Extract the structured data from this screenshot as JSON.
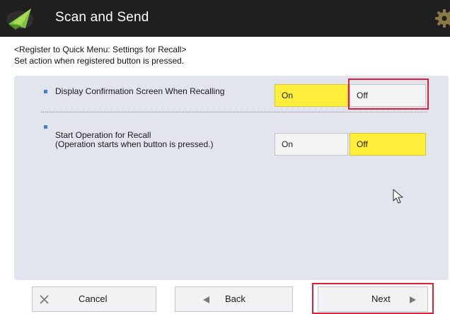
{
  "titlebar": {
    "title": "Scan and Send",
    "app_icon": "scan-send-icon",
    "settings_icon": "gear-icon"
  },
  "header": {
    "line1": "<Register to Quick Menu: Settings for Recall>",
    "line2": "Set action when registered button is pressed."
  },
  "settings": [
    {
      "label_lines": [
        "Display Confirmation Screen When Recalling"
      ],
      "options": [
        "On",
        "Off"
      ],
      "selected": "On"
    },
    {
      "label_lines": [
        "Start Operation for Recall",
        "(Operation starts when button is pressed.)"
      ],
      "options": [
        "On",
        "Off"
      ],
      "selected": "Off"
    }
  ],
  "footer": {
    "cancel_label": "Cancel",
    "back_label": "Back",
    "next_label": "Next"
  },
  "colors": {
    "titlebar": "#1f1f1f",
    "panel": "#e2e4ee",
    "selected_option": "#ffee3a",
    "highlight": "#e0203a",
    "bullet": "#3e7fd0"
  }
}
